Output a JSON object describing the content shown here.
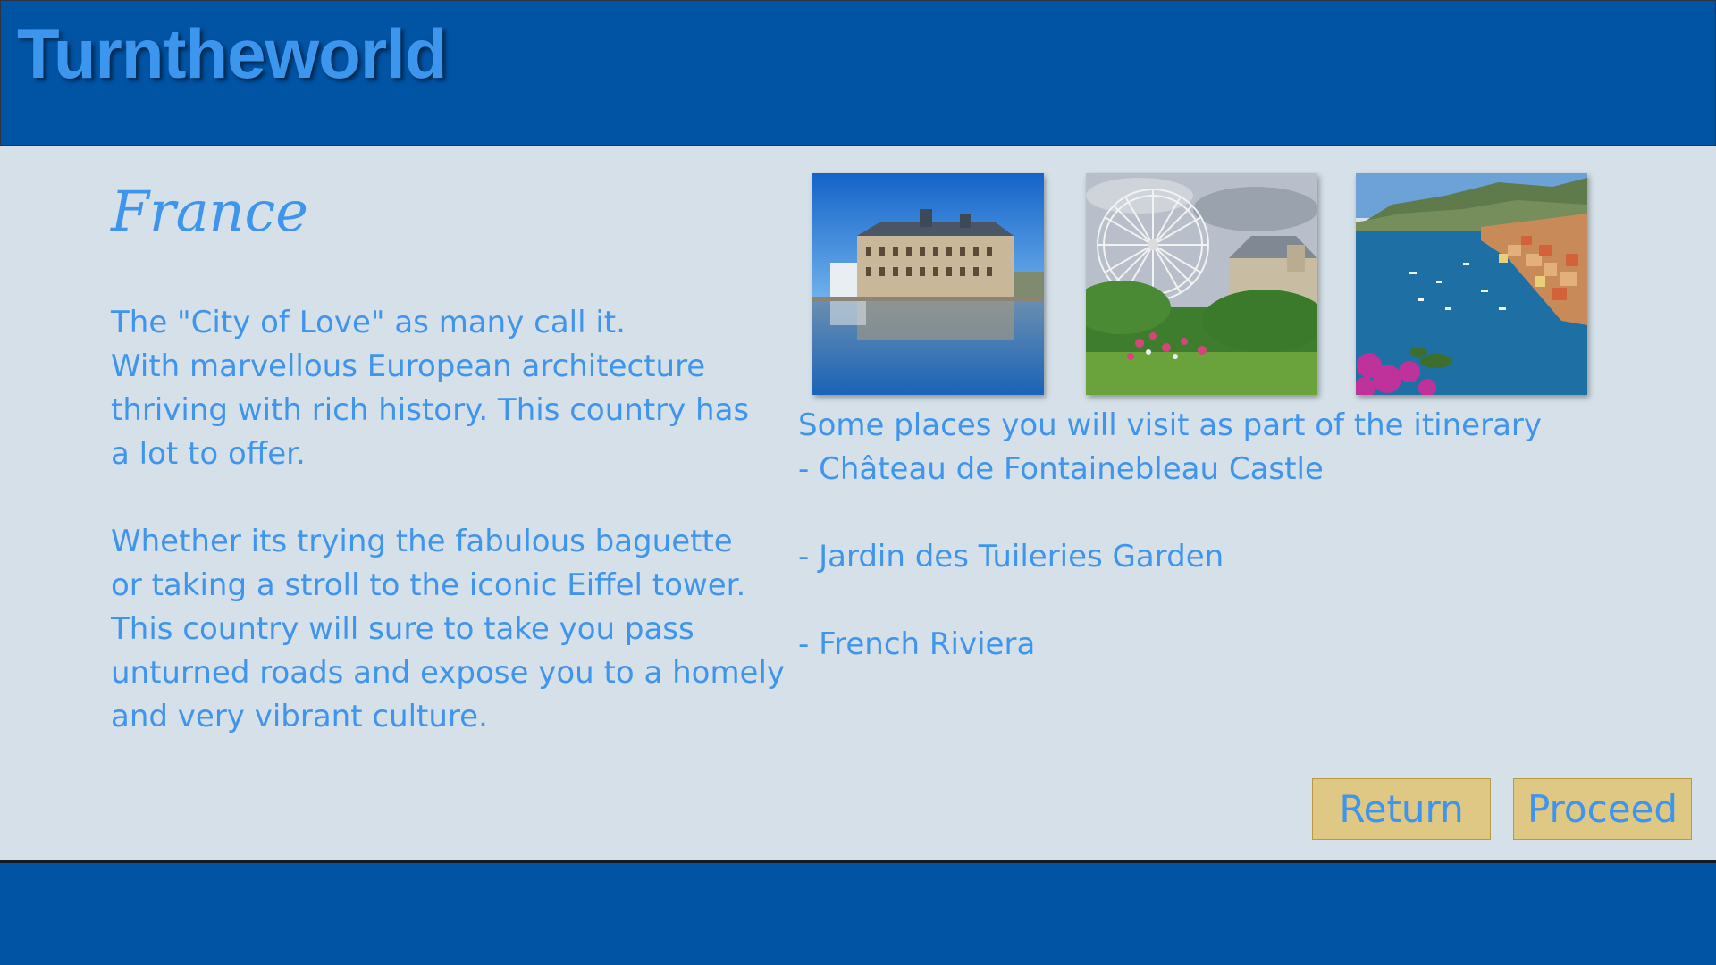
{
  "app": {
    "brand": "Turntheworld"
  },
  "country": {
    "title": "France",
    "intro_lines": [
      "The \"City of Love\" as many call it.",
      "With marvellous European architecture",
      "thriving with rich history. This country has",
      "a lot to offer."
    ],
    "detail_lines": [
      "Whether its trying the fabulous baguette",
      "or taking a stroll to the iconic Eiffel tower.",
      "This country will sure to take you pass",
      "unturned roads and expose you to a homely",
      "and very vibrant culture."
    ]
  },
  "itinerary": {
    "heading": "Some places you will visit as part of the itinerary",
    "places": [
      "- Château de Fontainebleau Castle",
      "- Jardin des Tuileries Garden",
      "- French Riviera"
    ]
  },
  "buttons": {
    "return_label": "Return",
    "proceed_label": "Proceed"
  },
  "colors": {
    "header": "#0153a4",
    "text": "#3f95ec",
    "background": "#d6e0e9",
    "button": "#dfc784"
  }
}
